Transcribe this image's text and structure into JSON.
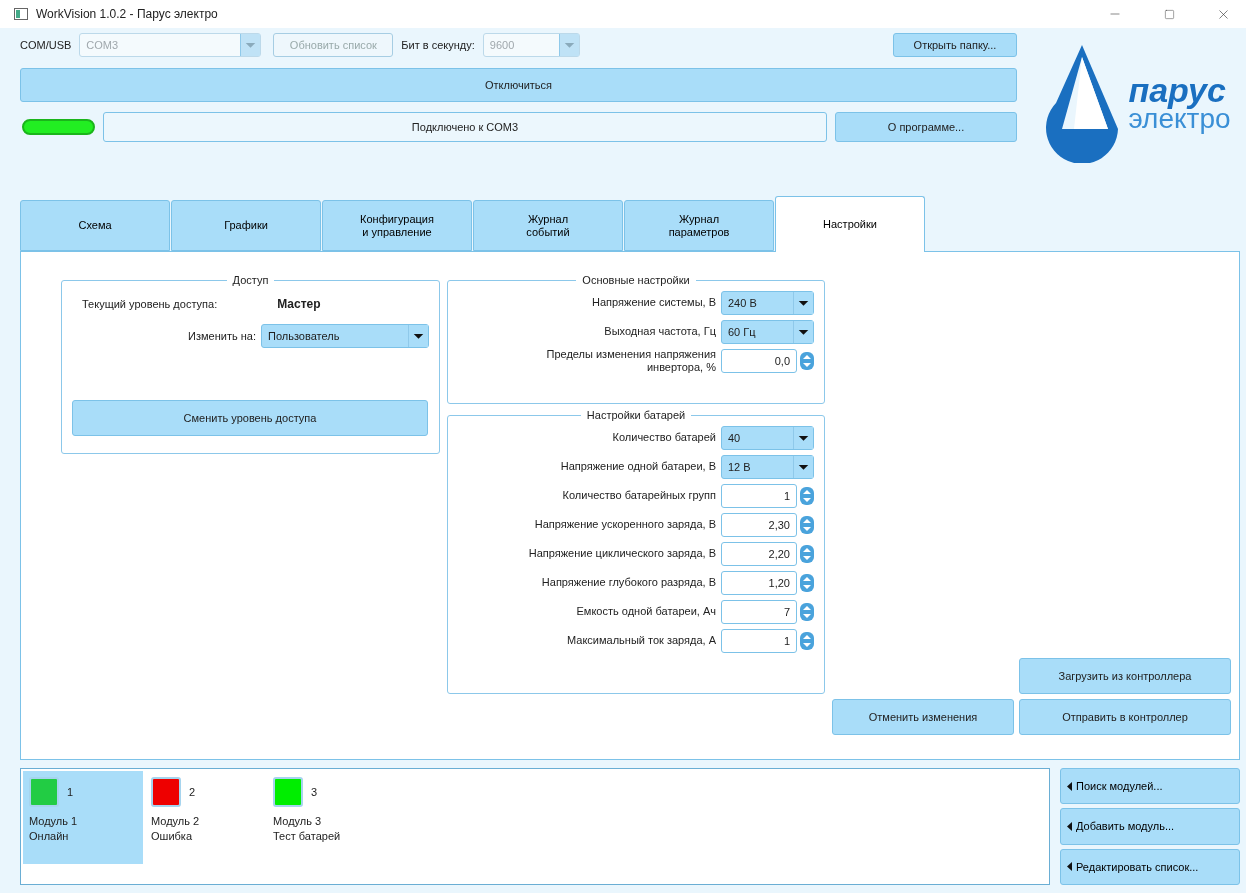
{
  "window": {
    "title": "WorkVision 1.0.2 - Парус электро"
  },
  "connection": {
    "port_label": "COM/USB",
    "port": {
      "value": "COM3",
      "disabled": true
    },
    "refresh_button": {
      "label": "Обновить список",
      "disabled": true
    },
    "baud_label": "Бит в секунду:",
    "baud": {
      "value": "9600",
      "disabled": true
    },
    "open_folder_button": "Открыть папку...",
    "disconnect_button": "Отключиться",
    "connected": true,
    "status": "Подключено к COM3",
    "about_button": "О программе..."
  },
  "logo": {
    "line_1": "парус",
    "line_2": "электро"
  },
  "tabs": [
    {
      "label": "Схема",
      "selected": false
    },
    {
      "label": "Графики",
      "selected": false
    },
    {
      "label": "Конфигурация\nи управление",
      "selected": false
    },
    {
      "label": "Журнал\nсобытий",
      "selected": false
    },
    {
      "label": "Журнал\nпараметров",
      "selected": false
    },
    {
      "label": "Настройки",
      "selected": true
    }
  ],
  "access": {
    "title": "Доступ",
    "current_label": "Текущий уровень доступа:",
    "current_value": "Мастер",
    "change_label": "Изменить на:",
    "change_value": "Пользователь",
    "apply_button": "Сменить уровень доступа"
  },
  "basic_settings": {
    "title": "Основные настройки",
    "fields": [
      {
        "label": "Напряжение системы, В",
        "kind": "combo",
        "value": "240 В"
      },
      {
        "label": "Выходная частота, Гц",
        "kind": "combo",
        "value": "60 Гц"
      },
      {
        "label": "Пределы изменения напряжения инвертора, %",
        "kind": "spin",
        "value": "0,0"
      }
    ]
  },
  "battery_settings": {
    "title": "Настройки батарей",
    "fields": [
      {
        "label": "Количество батарей",
        "kind": "combo",
        "value": "40"
      },
      {
        "label": "Напряжение одной батареи, В",
        "kind": "combo",
        "value": "12 В"
      },
      {
        "label": "Количество батарейных групп",
        "kind": "spin",
        "value": "1"
      },
      {
        "label": "Напряжение ускоренного заряда, В",
        "kind": "spin",
        "value": "2,30"
      },
      {
        "label": "Напряжение циклического заряда, В",
        "kind": "spin",
        "value": "2,20"
      },
      {
        "label": "Напряжение глубокого разряда, В",
        "kind": "spin",
        "value": "1,20"
      },
      {
        "label": "Емкость одной батареи, Ач",
        "kind": "spin",
        "value": "7"
      },
      {
        "label": "Максимальный ток заряда, А",
        "kind": "spin",
        "value": "1"
      }
    ]
  },
  "actions": {
    "load_button": "Загрузить из контроллера",
    "cancel_button": "Отменить изменения",
    "send_button": "Отправить в контроллер"
  },
  "modules": [
    {
      "number": "1",
      "name": "Модуль 1",
      "status": "Онлайн",
      "color": "#22cc44",
      "selected": true
    },
    {
      "number": "2",
      "name": "Модуль 2",
      "status": "Ошибка",
      "color": "#ee0000",
      "selected": false
    },
    {
      "number": "3",
      "name": "Модуль 3",
      "status": "Тест батарей",
      "color": "#00ee00",
      "selected": false
    }
  ],
  "module_buttons": [
    "Поиск модулей...",
    "Добавить модуль...",
    "Редактировать список..."
  ]
}
